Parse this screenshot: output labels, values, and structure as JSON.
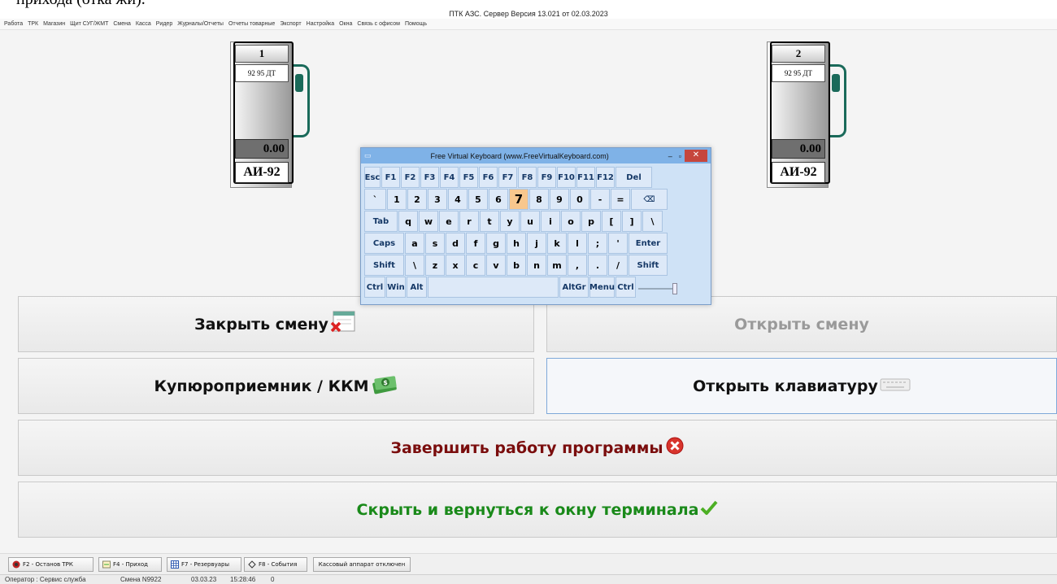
{
  "doc_strip_text": "прихода (отка жи).",
  "window_title": "ПТК АЗС. Сервер   Версия 13.021 от 02.03.2023",
  "menu": [
    "Работа",
    "ТРК",
    "Магазин",
    "Щит СУГ/ЖМТ",
    "Смена",
    "Касса",
    "Ридер",
    "Журналы/Отчеты",
    "Отчеты товарные",
    "Экспорт",
    "Настройка",
    "Окна",
    "Связь с офисом",
    "Помощь"
  ],
  "pumps": [
    {
      "number": "1",
      "grades": "92 95 ДТ",
      "display": "0.00",
      "fuel": "АИ-92"
    },
    {
      "number": "2",
      "grades": "92 95 ДТ",
      "display": "0.00",
      "fuel": "АИ-92"
    }
  ],
  "buttons": {
    "close_shift": "Закрыть смену",
    "open_shift": "Открыть смену",
    "bill_acceptor": "Купюроприемник / ККМ",
    "open_keyboard": "Открыть клавиатуру",
    "exit_program": "Завершить работу программы",
    "hide_return": "Скрыть и вернуться к окну терминала"
  },
  "keyboard": {
    "title": "Free Virtual Keyboard (www.FreeVirtualKeyboard.com)",
    "minimize": "–",
    "maximize": "▫",
    "close": "✕",
    "rows": [
      [
        "Esc",
        "F1",
        "F2",
        "F3",
        "F4",
        "F5",
        "F6",
        "F7",
        "F8",
        "F9",
        "F10",
        "F11",
        "F12",
        "Del"
      ],
      [
        "`",
        "1",
        "2",
        "3",
        "4",
        "5",
        "6",
        "7",
        "8",
        "9",
        "0",
        "-",
        "=",
        "⌫"
      ],
      [
        "Tab",
        "q",
        "w",
        "e",
        "r",
        "t",
        "y",
        "u",
        "i",
        "o",
        "p",
        "[",
        "]",
        "\\"
      ],
      [
        "Caps",
        "a",
        "s",
        "d",
        "f",
        "g",
        "h",
        "j",
        "k",
        "l",
        ";",
        "'",
        "Enter"
      ],
      [
        "Shift",
        "\\",
        "z",
        "x",
        "c",
        "v",
        "b",
        "n",
        "m",
        ",",
        ".",
        "/",
        "Shift"
      ],
      [
        "Ctrl",
        "Win",
        "Alt",
        "",
        "AltGr",
        "Menu",
        "Ctrl"
      ]
    ],
    "highlighted_key": "7"
  },
  "toolbar": {
    "f2": "F2 - Останов ТРК",
    "f4": "F4 - Приход",
    "f7": "F7 - Резервуары",
    "f8": "F8 - События",
    "cash_status": "Кассовый аппарат отключен"
  },
  "status": {
    "operator": "Оператор : Сервис служба",
    "shift": "Смена N9922",
    "date": "03.03.23",
    "time": "15:28:46",
    "counter": "0"
  },
  "colors": {
    "exit_text": "#7a0d0d",
    "hide_text": "#1a8a1a",
    "key_highlight": "#f8c78d",
    "kb_titlebar": "#7fb2e7"
  }
}
